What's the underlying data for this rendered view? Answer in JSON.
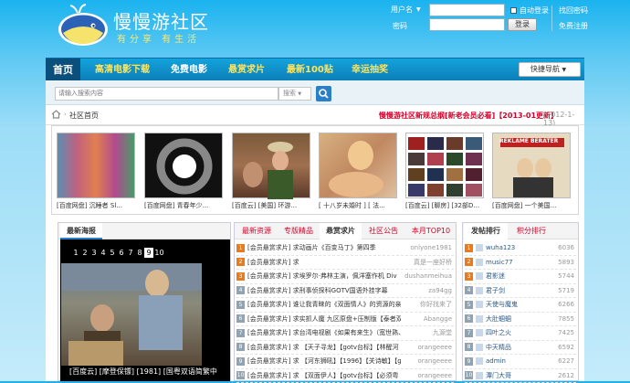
{
  "header": {
    "site_title": "慢慢游社区",
    "slogan": "有分享 有生活",
    "username_label": "用户名",
    "password_label": "密码",
    "auto_login": "自动登录",
    "login_button": "登录",
    "forgot_password": "找回密码",
    "register": "免费注册"
  },
  "nav": {
    "items": [
      {
        "label": "首页",
        "color": "#ffffff"
      },
      {
        "label": "高清电影下载",
        "color": "#ffe45a"
      },
      {
        "label": "免费电影",
        "color": "#ffffff"
      },
      {
        "label": "悬赏求片",
        "color": "#ffe45a"
      },
      {
        "label": "最新100贴",
        "color": "#ffe45a"
      },
      {
        "label": "幸运抽奖",
        "color": "#ffe45a"
      }
    ],
    "quick_nav": "快捷导航"
  },
  "search": {
    "placeholder": "请输入搜索内容",
    "category": "搜索"
  },
  "breadcrumb": {
    "current": "社区首页",
    "notice": "慢慢游社区新规总纲[新老会员必看]【2013-01更新】",
    "notice_date": "(2012-1-13)"
  },
  "thumbs": [
    {
      "caption": "[百度网盘] 沉睡者 Sl...",
      "color": "#d04070"
    },
    {
      "caption": "[百度网盘] 青春年少...",
      "color": "#222222"
    },
    {
      "caption": "[百度云] [美国] 环游...",
      "color": "#6a4a2a"
    },
    {
      "caption": "[ 十八岁未婚时 ] [ 法...",
      "color": "#c89a6a"
    },
    {
      "caption": "[百度云] [聊房] [32部D...",
      "color": "#443344"
    },
    {
      "caption": "[百度网盘] 一个美国...",
      "color": "#d4c7a8"
    }
  ],
  "poster": {
    "tab": "最新海报",
    "pages": [
      "1",
      "2",
      "3",
      "4",
      "5",
      "6",
      "7",
      "8",
      "9",
      "10"
    ],
    "active_page": "9",
    "caption": "[百度云] [摩登保镖] [1981] [国粤双语简繁中"
  },
  "middle": {
    "tabs": [
      "最新资源",
      "专版精品",
      "悬赏求片",
      "社区公告",
      "本月TOP10"
    ],
    "active_tab": "悬赏求片",
    "rows": [
      {
        "n": "1",
        "title": "[会员悬赏求片] 求动画片《百变马丁》第四季",
        "user": "onlyone1981"
      },
      {
        "n": "2",
        "title": "[会员悬赏求片] 求",
        "user": "真是一座好桥"
      },
      {
        "n": "3",
        "title": "[会员悬赏求片] 求埃罗尔·弗林主演，佩洋塞作机 Div",
        "user": "dushanmeihua"
      },
      {
        "n": "4",
        "title": "[会员悬赏求片] 求刑事侦探科GOTV国语外挂字幕",
        "user": "za94gg"
      },
      {
        "n": "5",
        "title": "[会员悬赏求片] 谁让我青睐的《双面情人》的资源的亲情",
        "user": "你好找来了"
      },
      {
        "n": "6",
        "title": "[会员悬赏求片] 求实抓人魔 九区原盘+压制版【泰者双语】",
        "user": "Abangge"
      },
      {
        "n": "7",
        "title": "[会员悬赏求片] 求台湾电视剧《如果有来生》（宽世熟、甄秀",
        "user": "九源堂"
      },
      {
        "n": "8",
        "title": "[会员悬赏求片] 求 【天子寻龙】【gotv台标】【林醒河",
        "user": "orangeeee"
      },
      {
        "n": "9",
        "title": "[会员悬赏求片] 求 【河东狮吼】【1996】【关诗敏】【g",
        "user": "orangeeee"
      },
      {
        "n": "10",
        "title": "[会员悬赏求片] 求 【双面伊人】【gotv台标】【必须粤",
        "user": "orangeeee"
      }
    ]
  },
  "right": {
    "tabs": [
      "发帖排行",
      "积分排行"
    ],
    "active_tab": "发帖排行",
    "rows": [
      {
        "n": "1",
        "name": "wuha123",
        "count": "6036"
      },
      {
        "n": "2",
        "name": "music77",
        "count": "5893"
      },
      {
        "n": "3",
        "name": "君影迷",
        "count": "5744"
      },
      {
        "n": "4",
        "name": "君子剑",
        "count": "5719"
      },
      {
        "n": "5",
        "name": "天使与魔鬼",
        "count": "6266"
      },
      {
        "n": "6",
        "name": "大肚蝈蝈",
        "count": "7855"
      },
      {
        "n": "7",
        "name": "四叶之火",
        "count": "7425"
      },
      {
        "n": "8",
        "name": "中天精品",
        "count": "6592"
      },
      {
        "n": "9",
        "name": "admin",
        "count": "6227"
      },
      {
        "n": "10",
        "name": "潭门大哥",
        "count": "2612"
      }
    ]
  },
  "colors": {
    "rank_top": "#e87b1c",
    "rank_other": "#8fa3b3",
    "accent_red": "#d4002a"
  }
}
